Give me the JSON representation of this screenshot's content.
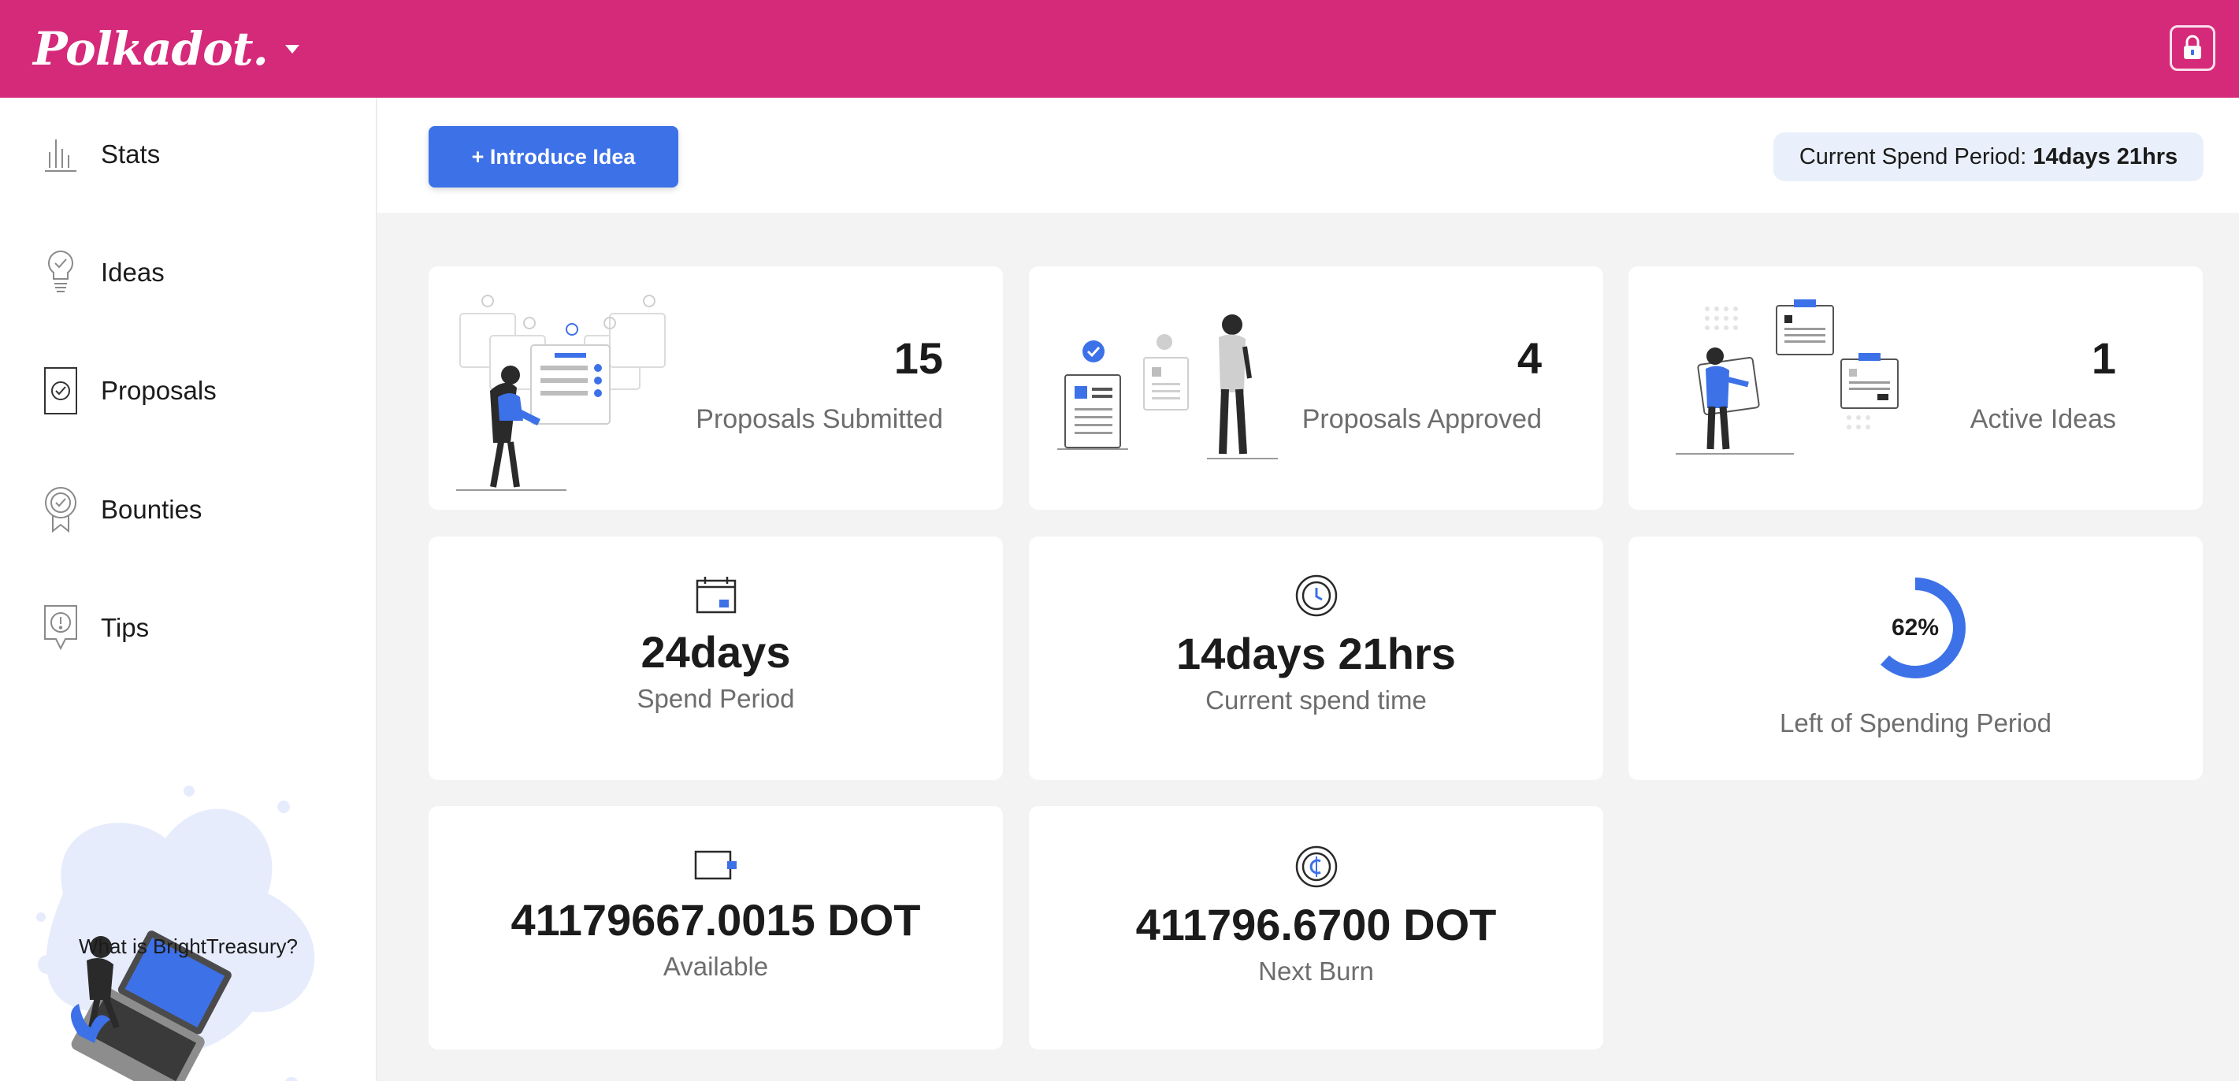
{
  "app": {
    "brand": "Polkadot."
  },
  "sidebar": {
    "items": [
      {
        "label": "Stats",
        "icon": "stats-icon"
      },
      {
        "label": "Ideas",
        "icon": "lightbulb-icon"
      },
      {
        "label": "Proposals",
        "icon": "proposal-check-icon"
      },
      {
        "label": "Bounties",
        "icon": "medal-icon"
      },
      {
        "label": "Tips",
        "icon": "tip-bubble-icon"
      }
    ],
    "promo_link": "What is BrightTreasury?"
  },
  "header": {
    "introduce_button": "+ Introduce Idea",
    "spend_period_label": "Current Spend Period:",
    "spend_period_value": "14days 21hrs"
  },
  "cards": {
    "proposals_submitted": {
      "value": "15",
      "label": "Proposals Submitted"
    },
    "proposals_approved": {
      "value": "4",
      "label": "Proposals Approved"
    },
    "active_ideas": {
      "value": "1",
      "label": "Active Ideas"
    },
    "spend_period": {
      "value": "24days",
      "label": "Spend Period",
      "icon": "calendar-icon"
    },
    "current_spend_time": {
      "value": "14days 21hrs",
      "label": "Current spend time",
      "icon": "clock-icon"
    },
    "left_of_spending": {
      "percent_text": "62%",
      "percent": 62,
      "label": "Left of Spending Period"
    },
    "available": {
      "value": "41179667.0015 DOT",
      "label": "Available",
      "icon": "wallet-icon"
    },
    "next_burn": {
      "value": "411796.6700 DOT",
      "label": "Next Burn",
      "icon": "coin-icon"
    }
  },
  "colors": {
    "topbar": "#d5297a",
    "accent": "#3d71e8",
    "muted_text": "#6d6d6d"
  }
}
